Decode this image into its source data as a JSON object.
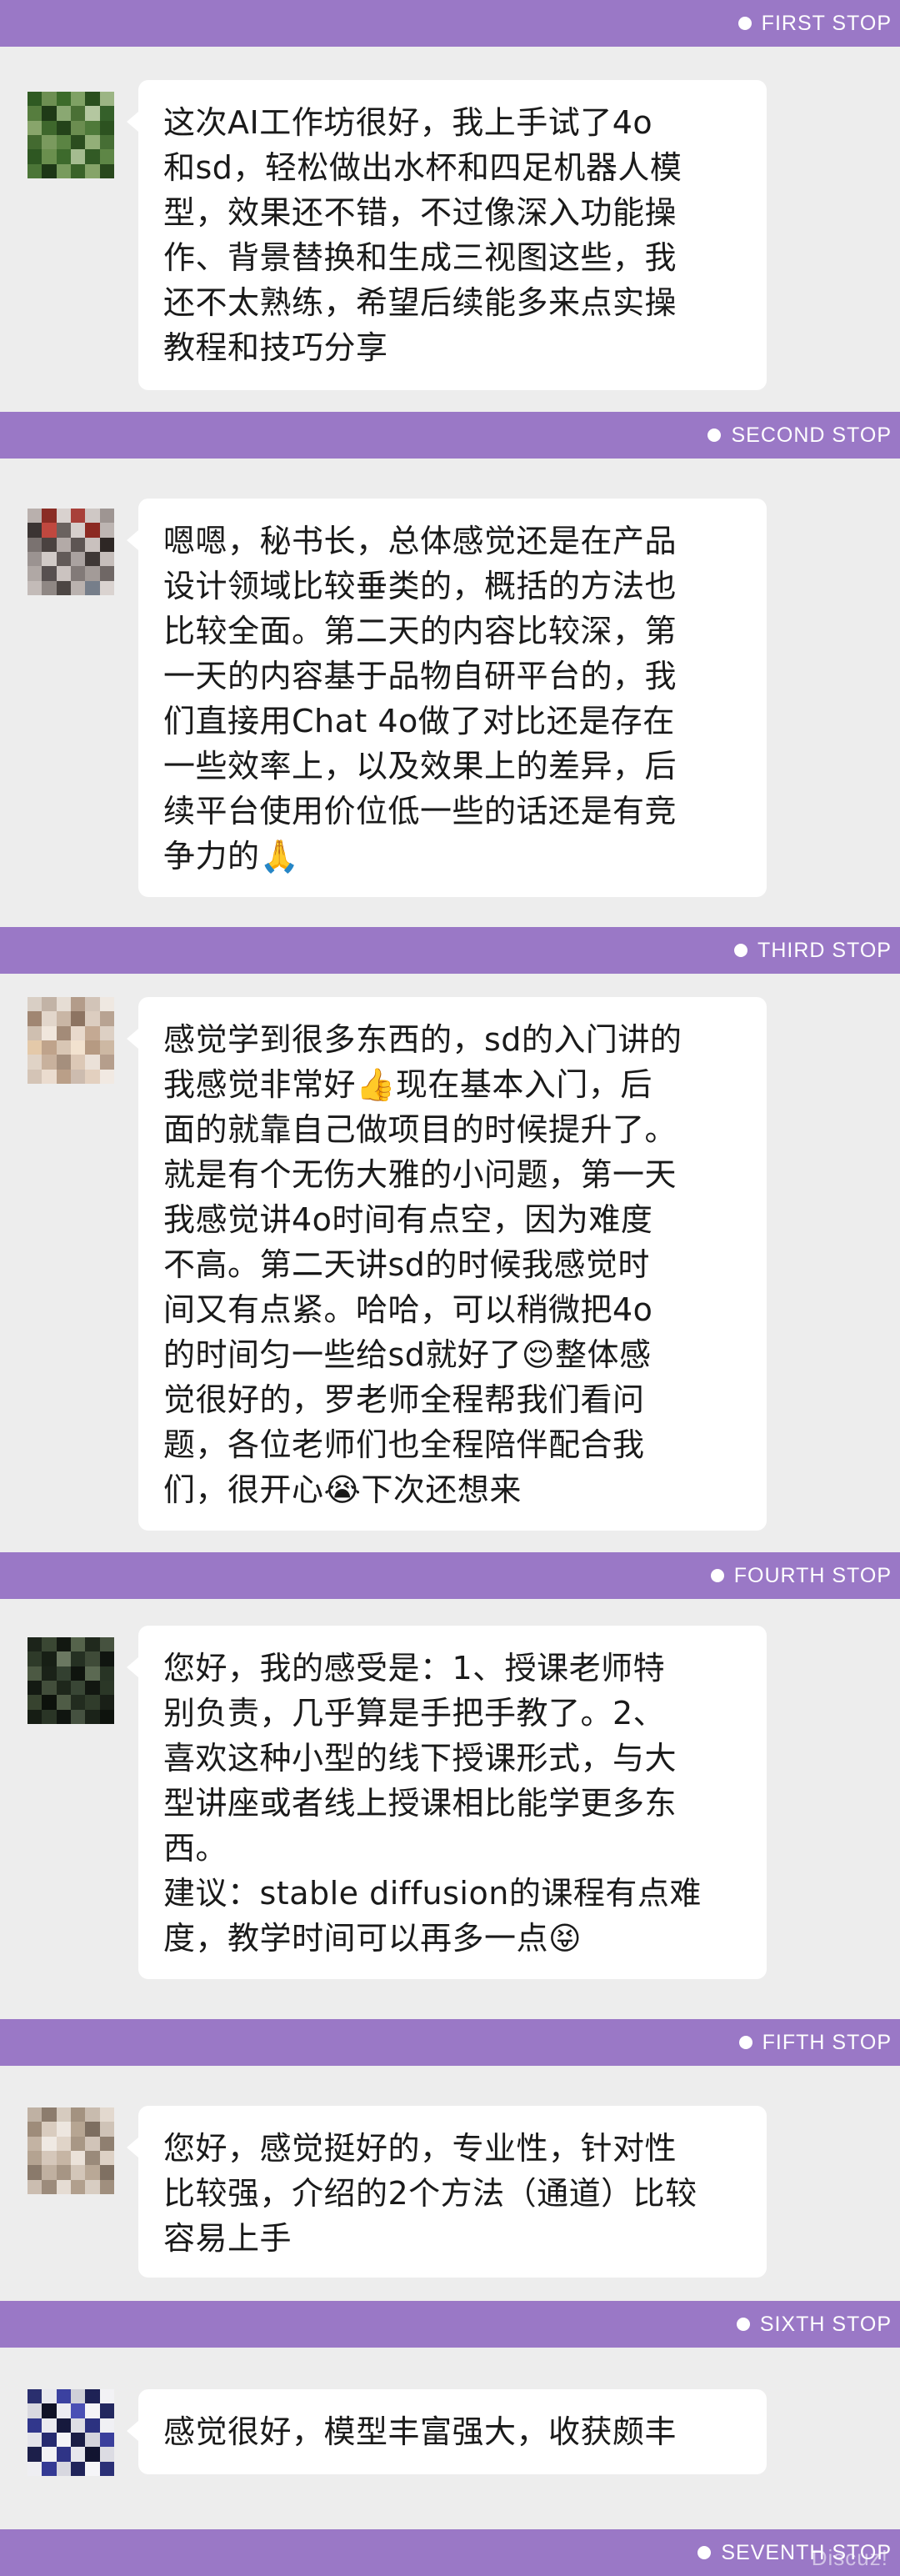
{
  "stops": [
    "FIRST STOP",
    "SECOND STOP",
    "THIRD STOP",
    "FOURTH STOP",
    "FIFTH STOP",
    "SIXTH STOP",
    "SEVENTH STOP"
  ],
  "messages": [
    {
      "avatar": "blurred-avatar-green",
      "lines": [
        "这次AI工作坊很好，我上手试了4o",
        "和sd，轻松做出水杯和四足机器人模",
        "型，效果还不错，不过像深入功能操",
        "作、背景替换和生成三视图这些，我",
        "还不太熟练，希望后续能多来点实操",
        "教程和技巧分享"
      ]
    },
    {
      "avatar": "blurred-avatar-red-grey",
      "lines": [
        "嗯嗯，秘书长，总体感觉还是在产品",
        "设计领域比较垂类的，概括的方法也",
        "比较全面。第二天的内容比较深，第",
        "一天的内容基于品物自研平台的，我",
        "们直接用Chat 4o做了对比还是存在",
        "一些效率上，以及效果上的差异，后",
        "续平台使用价位低一些的话还是有竞",
        "争力的🙏"
      ]
    },
    {
      "avatar": "blurred-avatar-beige",
      "lines": [
        "感觉学到很多东西的，sd的入门讲的",
        "我感觉非常好👍现在基本入门，后",
        "面的就靠自己做项目的时候提升了。",
        "就是有个无伤大雅的小问题，第一天",
        "我感觉讲4o时间有点空，因为难度",
        "不高。第二天讲sd的时候我感觉时",
        "间又有点紧。哈哈，可以稍微把4o",
        "的时间匀一些给sd就好了😌整体感",
        "觉很好的，罗老师全程帮我们看问",
        "题，各位老师们也全程陪伴配合我",
        "们，很开心😭下次还想来"
      ]
    },
    {
      "avatar": "blurred-avatar-dark-green",
      "lines": [
        "您好，我的感受是：1、授课老师特",
        "别负责，几乎算是手把手教了。2、",
        "喜欢这种小型的线下授课形式，与大",
        "型讲座或者线上授课相比能学更多东",
        "西。",
        "建议：stable diffusion的课程有点难",
        "度，教学时间可以再多一点😝"
      ]
    },
    {
      "avatar": "blurred-avatar-tan",
      "lines": [
        "您好，感觉挺好的，专业性，针对性",
        "比较强，介绍的2个方法（通道）比较",
        "容易上手"
      ]
    },
    {
      "avatar": "blurred-avatar-blue",
      "lines": [
        "感觉很好，模型丰富强大，收获颇丰"
      ]
    }
  ],
  "watermark": "Discuz!",
  "colors": {
    "stop_bar": "#9a78c6",
    "background": "#ededed",
    "bubble": "#ffffff",
    "text": "#1a1a1a"
  }
}
